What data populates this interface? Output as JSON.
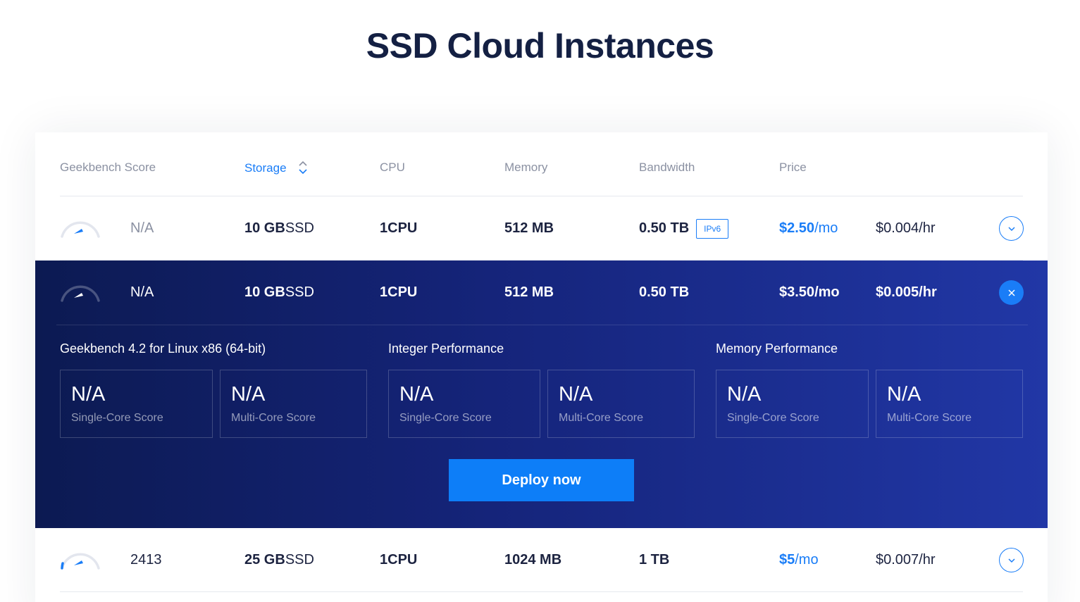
{
  "page": {
    "title": "SSD Cloud Instances"
  },
  "table": {
    "headers": {
      "geekbench": "Geekbench Score",
      "storage": "Storage",
      "cpu": "CPU",
      "memory": "Memory",
      "bandwidth": "Bandwidth",
      "price": "Price"
    },
    "rows": [
      {
        "geekbench": "N/A",
        "storage_value": "10 GB",
        "storage_unit": " SSD",
        "cpu_value": "1",
        "cpu_unit": " CPU",
        "memory": "512 MB",
        "bandwidth": "0.50 TB",
        "badge": "IPv6",
        "price_amount": "$2.50",
        "price_period": "/mo",
        "hourly": "$0.004/hr"
      },
      {
        "geekbench": "N/A",
        "storage_value": "10 GB",
        "storage_unit": " SSD",
        "cpu_value": "1",
        "cpu_unit": " CPU",
        "memory": "512 MB",
        "bandwidth": "0.50 TB",
        "price_amount": "$3.50",
        "price_period": "/mo",
        "hourly": "$0.005/hr"
      },
      {
        "geekbench": "2413",
        "storage_value": "25 GB",
        "storage_unit": " SSD",
        "cpu_value": "1",
        "cpu_unit": " CPU",
        "memory": "1024 MB",
        "bandwidth": "1 TB",
        "price_amount": "$5",
        "price_period": "/mo",
        "hourly": "$0.007/hr"
      }
    ]
  },
  "details": {
    "groups": [
      {
        "title": "Geekbench 4.2 for Linux x86 (64-bit)",
        "scores": [
          {
            "value": "N/A",
            "label": "Single-Core Score"
          },
          {
            "value": "N/A",
            "label": "Multi-Core Score"
          }
        ]
      },
      {
        "title": "Integer Performance",
        "scores": [
          {
            "value": "N/A",
            "label": "Single-Core Score"
          },
          {
            "value": "N/A",
            "label": "Multi-Core Score"
          }
        ]
      },
      {
        "title": "Memory Performance",
        "scores": [
          {
            "value": "N/A",
            "label": "Single-Core Score"
          },
          {
            "value": "N/A",
            "label": "Multi-Core Score"
          }
        ]
      }
    ],
    "deploy_label": "Deploy now"
  },
  "icons": {
    "sort": "sort-updown-icon",
    "expand": "chevron-down-icon",
    "close": "close-icon",
    "gauge": "speedometer-icon"
  },
  "colors": {
    "accent": "#1a7df7",
    "heading": "#142043",
    "panel_start": "#0c1a52",
    "panel_end": "#2137a6"
  }
}
